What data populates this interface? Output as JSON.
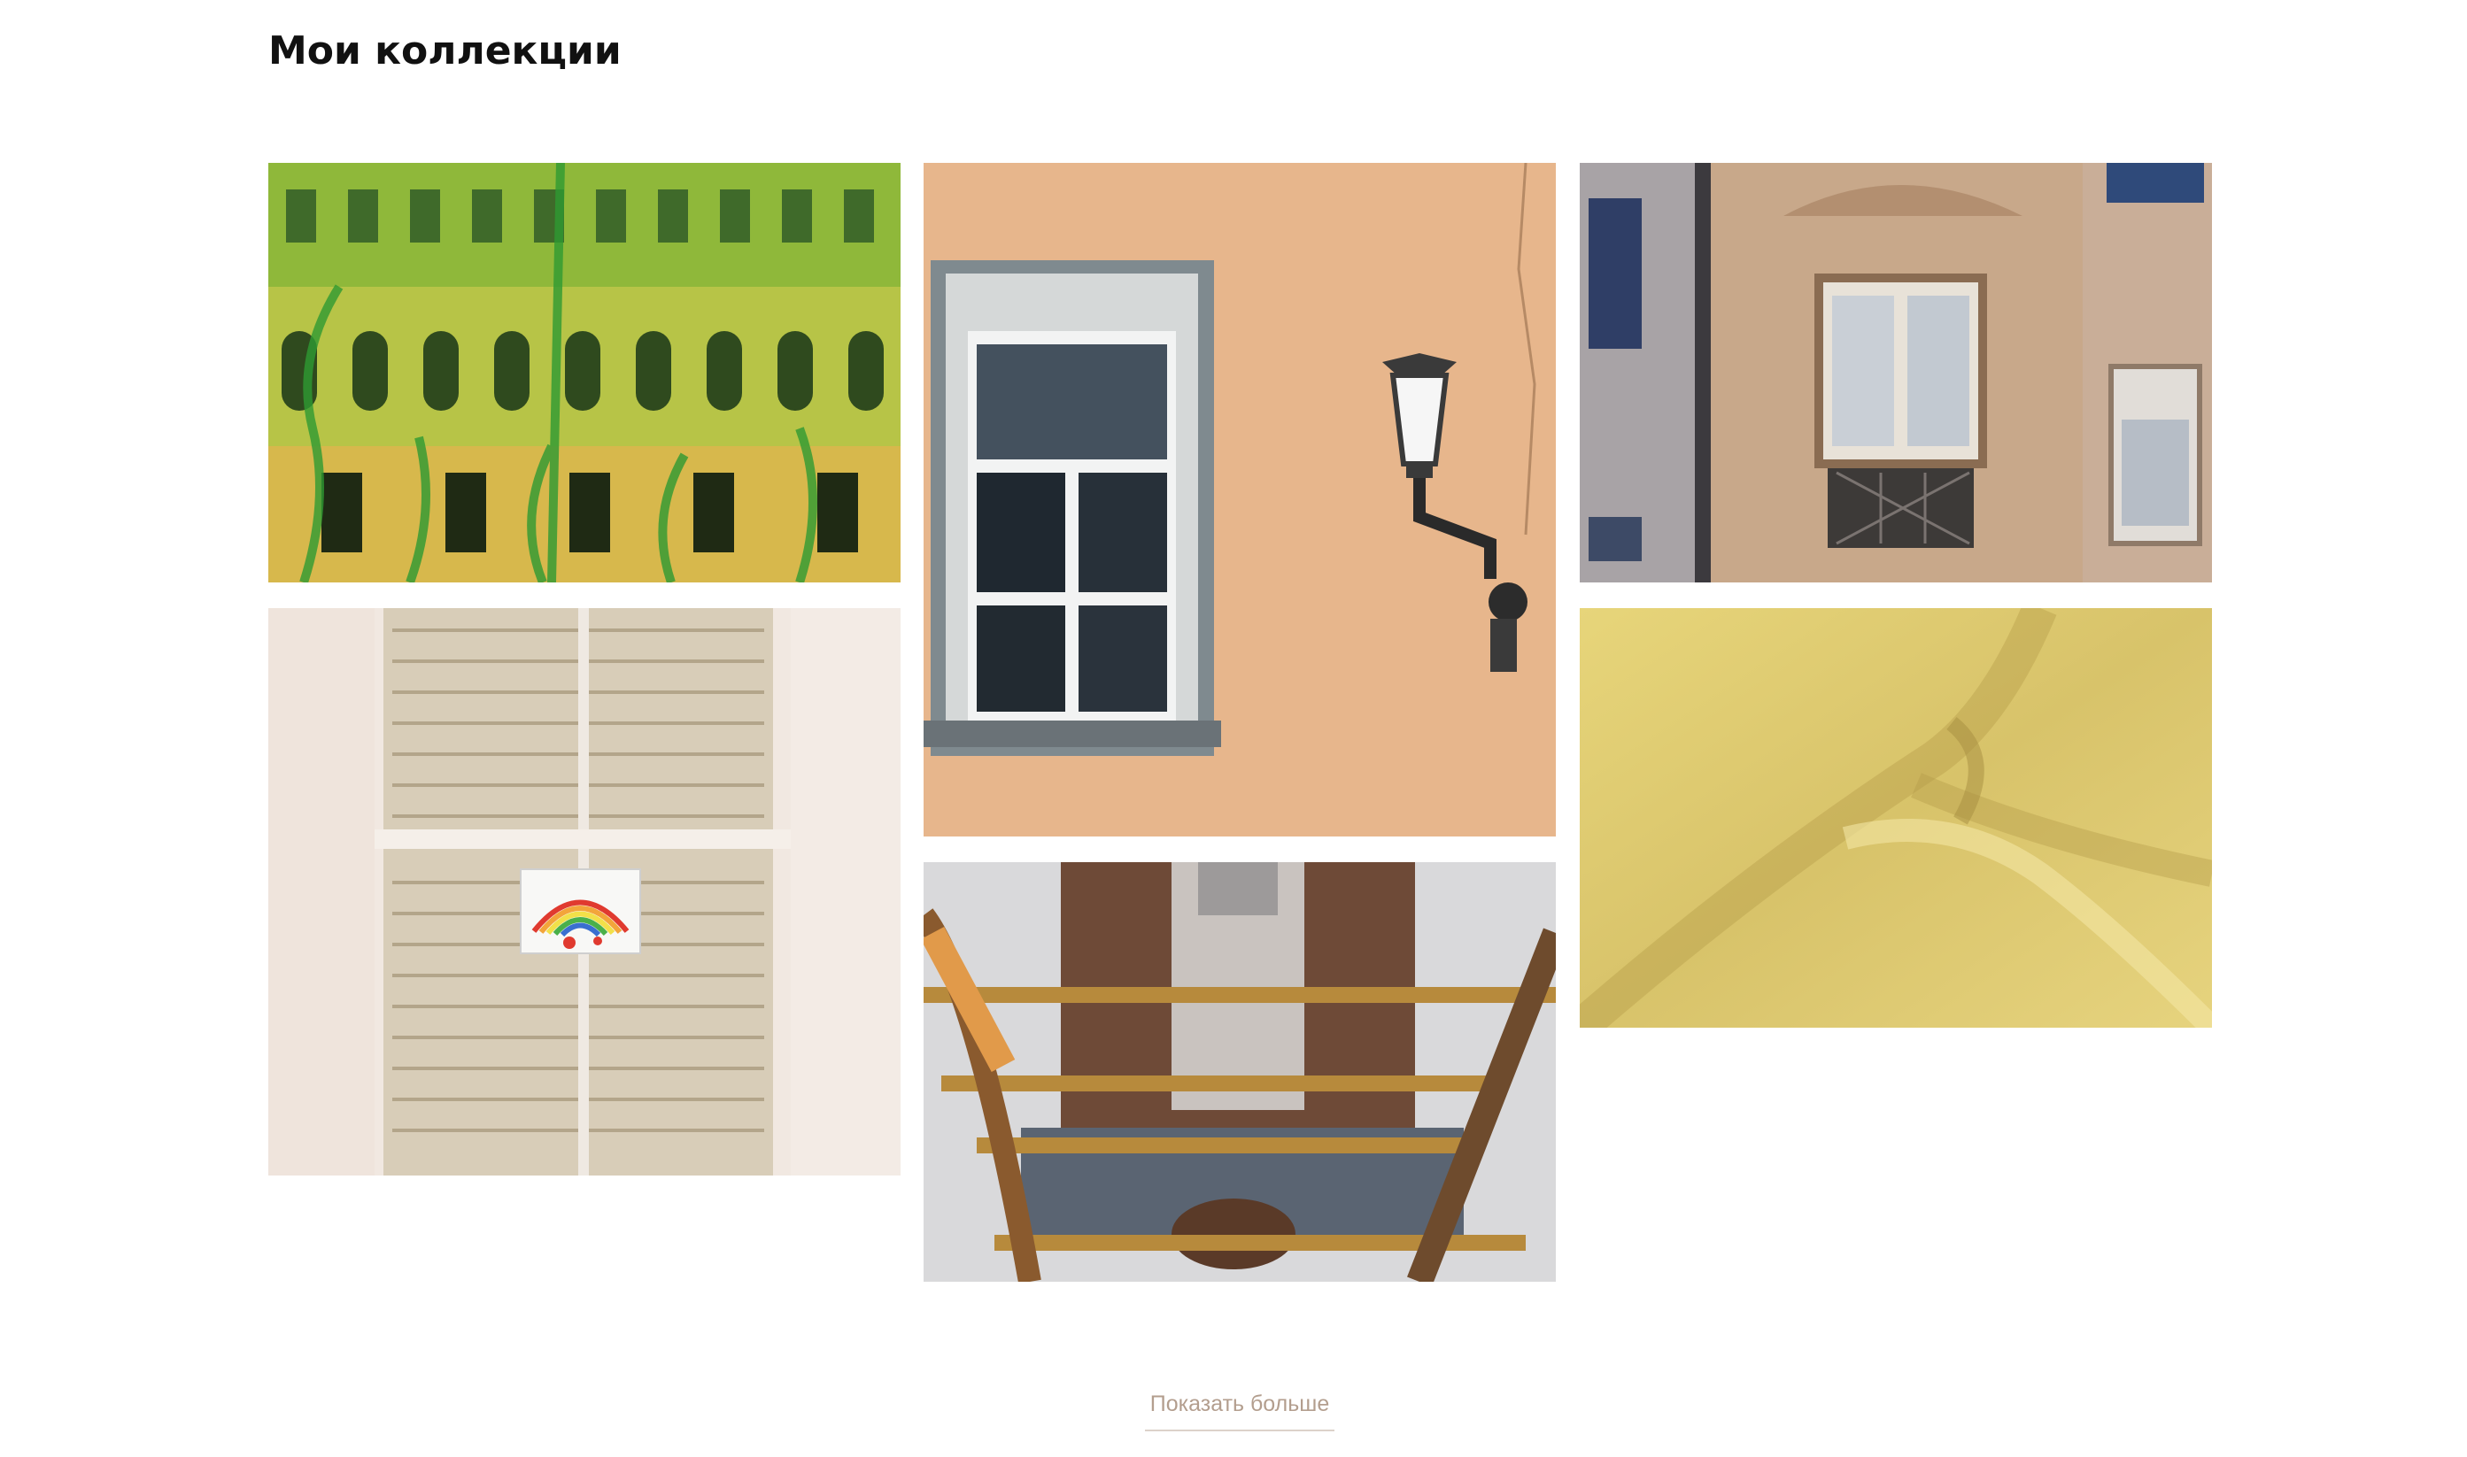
{
  "page": {
    "title": "Мои коллекции"
  },
  "gallery": {
    "items": [
      {
        "name": "collection-green-facade",
        "icon": "photo-green-building-facade"
      },
      {
        "name": "collection-window-lamp",
        "icon": "photo-window-with-street-lamp"
      },
      {
        "name": "collection-ornate-window",
        "icon": "photo-ornate-window-balcony"
      },
      {
        "name": "collection-shutters-rainbow",
        "icon": "photo-shutters-rainbow-drawing"
      },
      {
        "name": "collection-gold-fabric",
        "icon": "photo-gold-fabric"
      },
      {
        "name": "collection-person-ladder",
        "icon": "photo-person-behind-ladder"
      }
    ]
  },
  "actions": {
    "show_more_label": "Показать больше"
  },
  "colors": {
    "link": "#b39e8e",
    "title": "#111111",
    "background": "#ffffff"
  }
}
